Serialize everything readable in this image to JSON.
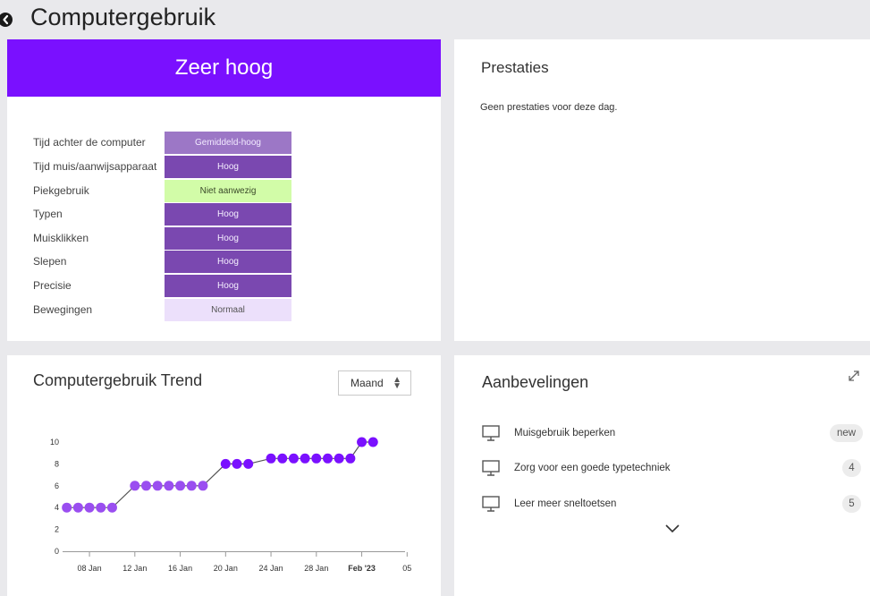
{
  "header": {
    "title": "Computergebruik"
  },
  "level_card": {
    "level": "Zeer hoog",
    "metrics": [
      {
        "label": "Tijd achter de computer",
        "value": "Gemiddeld-hoog",
        "color": "#9c77c6"
      },
      {
        "label": "Tijd muis/aanwijsapparaat",
        "value": "Hoog",
        "color": "#7a48b0"
      },
      {
        "label": "Piekgebruik",
        "value": "Niet aanwezig",
        "color": "#d2fca8"
      },
      {
        "label": "Typen",
        "value": "Hoog",
        "color": "#7a48b0"
      },
      {
        "label": "Muisklikken",
        "value": "Hoog",
        "color": "#7a48b0"
      },
      {
        "label": "Slepen",
        "value": "Hoog",
        "color": "#7a48b0"
      },
      {
        "label": "Precisie",
        "value": "Hoog",
        "color": "#7a48b0"
      },
      {
        "label": "Bewegingen",
        "value": "Normaal",
        "color": "#ece0fb"
      }
    ]
  },
  "achievements": {
    "title": "Prestaties",
    "empty_text": "Geen prestaties voor deze dag."
  },
  "trend": {
    "title": "Computergebruik Trend",
    "period_select": "Maand"
  },
  "recommendations": {
    "title": "Aanbevelingen",
    "items": [
      {
        "label": "Muisgebruik beperken",
        "badge": "new",
        "icon": "monitor-icon"
      },
      {
        "label": "Zorg voor een goede typetechniek",
        "badge": "4",
        "icon": "monitor-icon"
      },
      {
        "label": "Leer meer sneltoetsen",
        "badge": "5",
        "icon": "monitor-icon"
      }
    ]
  },
  "chart_data": {
    "type": "line",
    "x": [
      "06 Jan",
      "07 Jan",
      "08 Jan",
      "09 Jan",
      "10 Jan",
      "12 Jan",
      "13 Jan",
      "14 Jan",
      "15 Jan",
      "16 Jan",
      "17 Jan",
      "18 Jan",
      "20 Jan",
      "21 Jan",
      "22 Jan",
      "24 Jan",
      "25 Jan",
      "26 Jan",
      "27 Jan",
      "28 Jan",
      "29 Jan",
      "30 Jan",
      "31 Jan",
      "01 Feb",
      "02 Feb"
    ],
    "series": [
      {
        "values": [
          4,
          4,
          4,
          4,
          4,
          6,
          6,
          6,
          6,
          6,
          6,
          6,
          8,
          8,
          8,
          8.5,
          8.5,
          8.5,
          8.5,
          8.5,
          8.5,
          8.5,
          8.5,
          10,
          10
        ]
      }
    ],
    "y_ticks": [
      0,
      2,
      4,
      6,
      8,
      10
    ],
    "x_tick_labels": [
      "08 Jan",
      "12 Jan",
      "16 Jan",
      "20 Jan",
      "24 Jan",
      "28 Jan",
      "Feb '23",
      "05"
    ],
    "x_tick_dates": [
      "08 Jan",
      "12 Jan",
      "16 Jan",
      "20 Jan",
      "24 Jan",
      "28 Jan",
      "01 Feb",
      "05 Feb"
    ],
    "ylim": [
      0,
      10
    ],
    "xlim": [
      "05 Jan",
      "06 Feb"
    ],
    "colors": {
      "line": "#555555",
      "point": "#7a10ff",
      "point_light": "#9a4ef0"
    },
    "grid": false
  }
}
